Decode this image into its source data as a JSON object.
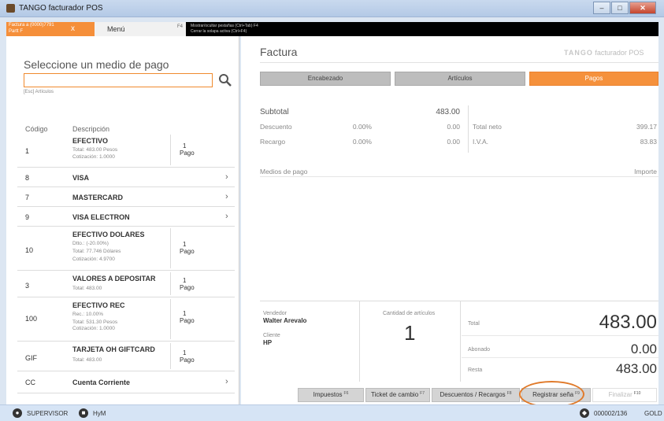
{
  "window": {
    "title": "TANGO facturador POS",
    "btn_min": "–",
    "btn_max": "□",
    "btn_close": "✕"
  },
  "tabs": {
    "factura_line1": "Factura a (0000)7791",
    "factura_line2": "Partt F",
    "factura_close": "x",
    "menu_label": "Menú",
    "menu_key": "F4",
    "hint_line1": "Mostrar/ocultar pestañas (Ctrl+Tab) F4",
    "hint_line2": "Cerrar la solapa activa (Ctrl+F4)"
  },
  "left": {
    "heading": "Seleccione un medio de pago",
    "search_value": "",
    "hint": "[Esc] Artículos",
    "col_code": "Código",
    "col_desc": "Descripción",
    "rows": [
      {
        "code": "1",
        "name": "EFECTIVO",
        "details": [
          "Total:  483.00   Pesos",
          "Cotización:  1.0000"
        ],
        "pago_n": "1",
        "pago_l": "Pago"
      },
      {
        "code": "8",
        "name": "VISA",
        "chev": "›"
      },
      {
        "code": "7",
        "name": "MASTERCARD",
        "chev": "›"
      },
      {
        "code": "9",
        "name": "VISA ELECTRON",
        "chev": "›"
      },
      {
        "code": "10",
        "name": "EFECTIVO DOLARES",
        "details": [
          "Dtto.: (-20.00%)",
          "Total:  77.746   Dólares",
          "Cotización:  4.9700"
        ],
        "pago_n": "1",
        "pago_l": "Pago"
      },
      {
        "code": "3",
        "name": "VALORES A DEPOSITAR",
        "details": [
          "Total:  483.00"
        ],
        "pago_n": "1",
        "pago_l": "Pago"
      },
      {
        "code": "100",
        "name": "EFECTIVO REC",
        "details": [
          "Rec.: 10.00%",
          "Total:  531.30   Pesos",
          "Cotización:  1.0000"
        ],
        "pago_n": "1",
        "pago_l": "Pago"
      },
      {
        "code": "GIF",
        "name": "TARJETA OH GIFTCARD",
        "details": [
          "Total:  483.00"
        ],
        "pago_n": "1",
        "pago_l": "Pago"
      },
      {
        "code": "CC",
        "name": "Cuenta Corriente",
        "chev": "›"
      }
    ]
  },
  "right": {
    "title": "Factura",
    "logo_brand": "TANGO",
    "logo_text": "facturador POS",
    "tabs": [
      "Encabezado",
      "Artículos",
      "Pagos"
    ],
    "subtotal_label": "Subtotal",
    "subtotal_value": "483.00",
    "descuento_label": "Descuento",
    "descuento_pct": "0.00%",
    "descuento_value": "0.00",
    "recargo_label": "Recargo",
    "recargo_pct": "0.00%",
    "recargo_value": "0.00",
    "total_neto_label": "Total neto",
    "total_neto_value": "399.17",
    "iva_label": "I.V.A.",
    "iva_value": "83.83",
    "medios_label": "Medios de pago",
    "importe_label": "Importe",
    "vendedor_label": "Vendedor",
    "vendedor_value": "Walter Arevalo",
    "cliente_label": "Cliente",
    "cliente_value": "HP",
    "cantidad_label": "Cantidad de artículos",
    "cantidad_value": "1",
    "total_label": "Total",
    "total_value": "483.00",
    "abonado_label": "Abonado",
    "abonado_value": "0.00",
    "resta_label": "Resta",
    "resta_value": "483.00"
  },
  "footer_buttons": [
    {
      "label": "Impuestos",
      "key": "F6"
    },
    {
      "label": "Ticket de cambio",
      "key": "F7"
    },
    {
      "label": "Descuentos / Recargos",
      "key": "F8"
    },
    {
      "label": "Registrar seña",
      "key": "F9"
    },
    {
      "label": "Finalizar",
      "key": "F10"
    }
  ],
  "status": {
    "user": "SUPERVISOR",
    "company": "HyM",
    "counter": "000002/136",
    "truncated": "GOLD"
  }
}
